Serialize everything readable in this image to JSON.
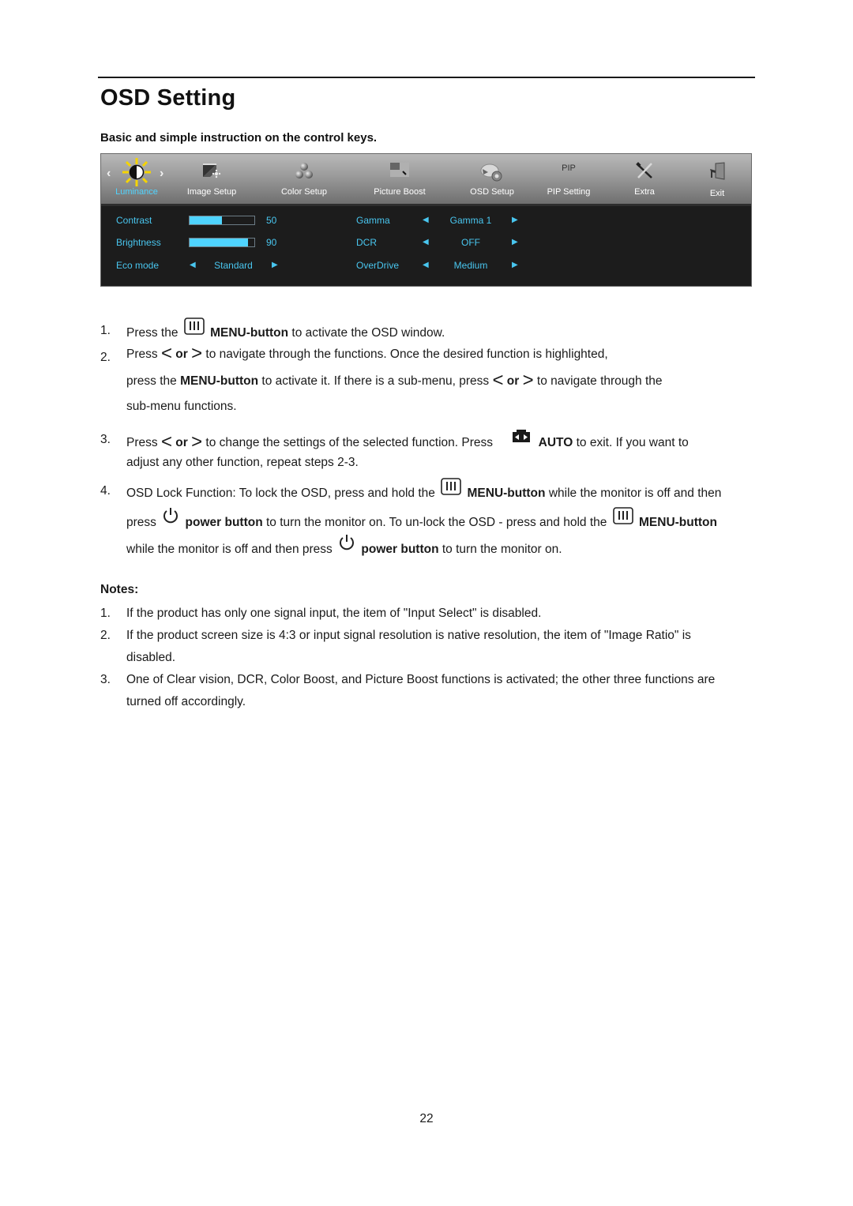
{
  "page": {
    "title": "OSD Setting",
    "subtitle": "Basic and simple instruction on the control keys.",
    "page_number": "22"
  },
  "osd": {
    "tabs": [
      {
        "label": "Luminance",
        "icon": "sun-contrast-icon",
        "active": true
      },
      {
        "label": "Image Setup",
        "icon": "image-setup-icon",
        "active": false
      },
      {
        "label": "Color Setup",
        "icon": "color-balls-icon",
        "active": false
      },
      {
        "label": "Picture Boost",
        "icon": "picture-boost-icon",
        "active": false
      },
      {
        "label": "OSD Setup",
        "icon": "osd-setup-icon",
        "active": false
      },
      {
        "label": "PIP Setting",
        "icon": "pip-icon",
        "active": false,
        "icon_text": "PIP"
      },
      {
        "label": "Extra",
        "icon": "tools-icon",
        "active": false
      },
      {
        "label": "Exit",
        "icon": "exit-door-icon",
        "active": false
      }
    ],
    "nav_left": "‹",
    "nav_right": "›",
    "accent_color": "#4fd4ff",
    "settings_left": [
      {
        "label": "Contrast",
        "type": "slider",
        "value": "50",
        "fraction": 0.5
      },
      {
        "label": "Brightness",
        "type": "slider",
        "value": "90",
        "fraction": 0.9
      },
      {
        "label": "Eco mode",
        "type": "selector",
        "value": "Standard"
      }
    ],
    "settings_right": [
      {
        "label": "Gamma",
        "type": "selector",
        "value": "Gamma 1"
      },
      {
        "label": "DCR",
        "type": "selector",
        "value": "OFF"
      },
      {
        "label": "OverDrive",
        "type": "selector",
        "value": "Medium"
      }
    ],
    "arrow_left": "◀",
    "arrow_right": "▶"
  },
  "steps": {
    "s1": {
      "num": "1.",
      "a": "Press the",
      "b": "MENU-button",
      "c": "to activate the OSD window."
    },
    "s2": {
      "num": "2.",
      "l1a": "Press",
      "or": "or",
      "l1b": "to navigate through the functions. Once the desired function is highlighted,",
      "l2a": "press the",
      "l2b": "MENU-button",
      "l2c": "to activate it. If there is a sub-menu, press",
      "l2d": "to navigate through the",
      "l3": "sub-menu functions."
    },
    "s3": {
      "num": "3.",
      "l1a": "Press",
      "or": "or",
      "l1b": "to change the settings of the selected function. Press",
      "l1c": "AUTO",
      "l1d": "to exit. If you want to",
      "l2": "adjust any other function, repeat steps 2-3."
    },
    "s4": {
      "num": "4.",
      "l1a": "OSD Lock Function: To lock the OSD, press and hold the",
      "l1b": "MENU-button",
      "l1c": "while the monitor is off and then",
      "l2a": "press",
      "l2b": "power button",
      "l2c": "to turn the monitor on. To un-lock the OSD - press and hold the",
      "l2d": "MENU-button",
      "l3a": "while the monitor is off and then press",
      "l3b": "power button",
      "l3c": "to turn the monitor on."
    },
    "chev_left": "<",
    "chev_right": ">"
  },
  "notes": {
    "heading": "Notes:",
    "items": [
      {
        "num": "1.",
        "lines": [
          "If the product has only one signal input, the item of \"Input Select\" is disabled."
        ]
      },
      {
        "num": "2.",
        "lines": [
          "If the product screen size is 4:3 or input signal resolution is native resolution, the item of \"Image Ratio\" is",
          "disabled."
        ]
      },
      {
        "num": "3.",
        "lines": [
          "One of Clear vision, DCR, Color Boost, and Picture Boost functions is activated; the other three functions are",
          "turned off accordingly."
        ]
      }
    ]
  }
}
